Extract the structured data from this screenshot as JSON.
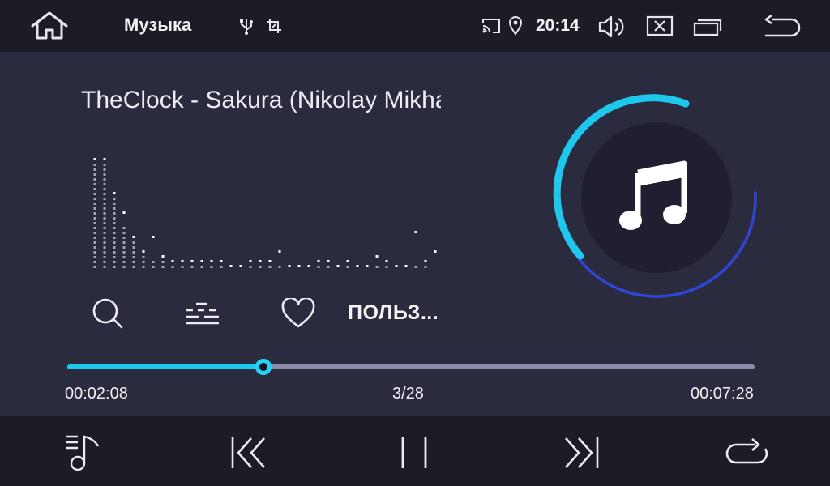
{
  "app": {
    "title": "Музыка"
  },
  "status": {
    "time": "20:14"
  },
  "player": {
    "track_title": "TheClock - Sakura (Nikolay Mikhaylov Remix)",
    "playlist_name": "ПОЛЬЗ...",
    "elapsed": "00:02:08",
    "duration": "00:07:28",
    "track_position": "3/28",
    "progress": 0.285
  },
  "spectrum": {
    "levels": [
      22,
      22,
      15,
      9,
      6,
      3,
      2,
      2,
      1,
      1,
      1,
      1,
      1,
      1,
      0,
      0,
      1,
      1,
      1,
      1,
      0,
      0,
      0,
      1,
      1,
      0,
      1,
      0,
      0,
      1,
      1,
      0,
      0,
      1,
      1
    ],
    "peaks": [
      22,
      22,
      14,
      11,
      3,
      0,
      6,
      0,
      0,
      0,
      0,
      0,
      0,
      0,
      0,
      0,
      0,
      1,
      1,
      3,
      0,
      0,
      0,
      0,
      0,
      0,
      0,
      0,
      0,
      2,
      1,
      0,
      0,
      7,
      0,
      3,
      1
    ],
    "colors": {
      "bar": "#a3a3b8",
      "peak": "#ffffff"
    }
  },
  "colors": {
    "background": "#2b2b3f",
    "bar": "#1c1c26",
    "accent": "#1ec8ec",
    "ring_outer": "#2f45d8",
    "disc": "#1f1f31"
  },
  "icons": {
    "home": "home-icon",
    "usb": "usb-icon",
    "screenshot": "screenshot-icon",
    "cast": "cast-icon",
    "location": "location-icon",
    "volume": "volume-icon",
    "close": "close-icon",
    "windows": "recent-apps-icon",
    "back": "back-icon",
    "search": "search-icon",
    "equalizer": "equalizer-icon",
    "favorite": "heart-icon",
    "playlist": "playlist-icon",
    "previous": "previous-track-icon",
    "pause": "pause-icon",
    "next": "next-track-icon",
    "repeat": "repeat-icon"
  }
}
